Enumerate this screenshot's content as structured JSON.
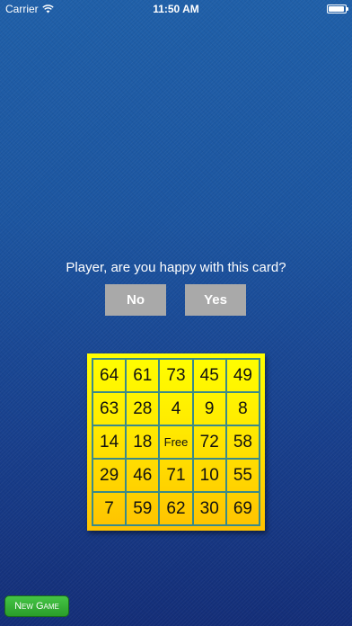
{
  "status_bar": {
    "carrier": "Carrier",
    "time": "11:50 AM",
    "wifi_icon": "wifi-icon",
    "battery_icon": "battery-icon"
  },
  "prompt": {
    "text": "Player, are you happy with this card?"
  },
  "buttons": {
    "no_label": "No",
    "yes_label": "Yes",
    "new_game_label": "New Game"
  },
  "card": {
    "cells": [
      [
        "64",
        "61",
        "73",
        "45",
        "49"
      ],
      [
        "63",
        "28",
        "4",
        "9",
        "8"
      ],
      [
        "14",
        "18",
        "Free",
        "72",
        "58"
      ],
      [
        "29",
        "46",
        "71",
        "10",
        "55"
      ],
      [
        "7",
        "59",
        "62",
        "30",
        "69"
      ]
    ]
  },
  "colors": {
    "background_top": "#1f5fa8",
    "background_bottom": "#142e78",
    "button_gray": "#a9a9a9",
    "card_yellow": "#ffff00",
    "card_orange": "#ffc200",
    "grid_line": "#3a8a8a",
    "new_game_green": "#2a9d2a"
  }
}
